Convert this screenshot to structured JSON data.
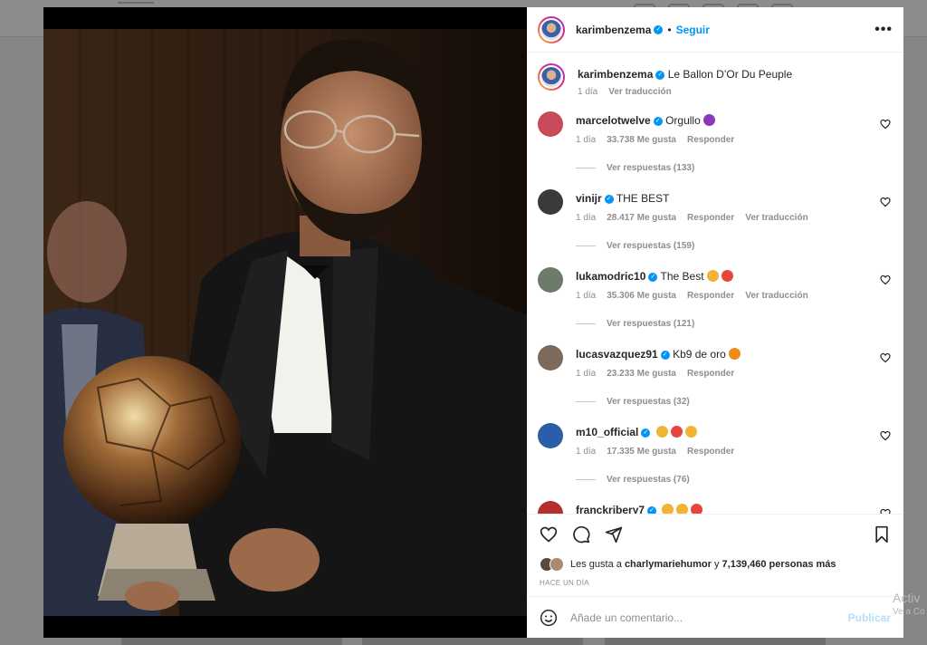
{
  "post": {
    "author": "karimbenzema",
    "follow_label": "Seguir",
    "dot": "•",
    "more_label": "•••",
    "caption": "Le Ballon D’Or Du Peuple",
    "caption_age": "1 día",
    "caption_translate": "Ver traducción"
  },
  "comments": [
    {
      "user": "marcelotwelve",
      "text": "Orgullo",
      "emoji": "purple-heart",
      "emoji_color": "#8a3ab9",
      "age": "1 día",
      "likes": "33.738 Me gusta",
      "reply": "Responder",
      "translate": "",
      "replies": "Ver respuestas (133)",
      "avatar_color": "#c84b5a"
    },
    {
      "user": "vinijr",
      "text": "THE BEST",
      "emoji": "",
      "emoji_color": "",
      "age": "1 día",
      "likes": "28.417 Me gusta",
      "reply": "Responder",
      "translate": "Ver traducción",
      "replies": "Ver respuestas (159)",
      "avatar_color": "#3a3a3a"
    },
    {
      "user": "lukamodric10",
      "text": "The Best",
      "emoji": "hands-heart",
      "emoji_color": "#e8453c",
      "age": "1 día",
      "likes": "35.306 Me gusta",
      "reply": "Responder",
      "translate": "Ver traducción",
      "replies": "Ver respuestas (121)",
      "avatar_color": "#6e7a6a"
    },
    {
      "user": "lucasvazquez91",
      "text": "Kb9 de oro",
      "emoji": "fire",
      "emoji_color": "#f28a1b",
      "age": "1 día",
      "likes": "23.233 Me gusta",
      "reply": "Responder",
      "translate": "",
      "replies": "Ver respuestas (32)",
      "avatar_color": "#7c6a5c"
    },
    {
      "user": "m10_official",
      "text": "",
      "emoji": "hands-heart-clap",
      "emoji_color": "#e8453c",
      "age": "1 día",
      "likes": "17.335 Me gusta",
      "reply": "Responder",
      "translate": "",
      "replies": "Ver respuestas (76)",
      "avatar_color": "#2a5ea8"
    },
    {
      "user": "franckribery7",
      "text": "",
      "emoji": "pray-clap-heart",
      "emoji_color": "#e8453c",
      "age": "",
      "likes": "",
      "reply": "",
      "translate": "",
      "replies": "",
      "avatar_color": "#b43030"
    }
  ],
  "likes_line": {
    "prefix": "Les gusta a",
    "user": "charlymariehumor",
    "connector": "y",
    "count": "7,139,460 personas más"
  },
  "posted_ago": "HACE UN DÍA",
  "add_comment": {
    "placeholder": "Añade un comentario...",
    "publish_label": "Publicar"
  },
  "watermark": {
    "line1": "Activ",
    "line2": "Ve a Co"
  },
  "colors": {
    "accent": "#0095f6",
    "publish_disabled": "#b2dffc",
    "muted": "#8e8e8e"
  }
}
